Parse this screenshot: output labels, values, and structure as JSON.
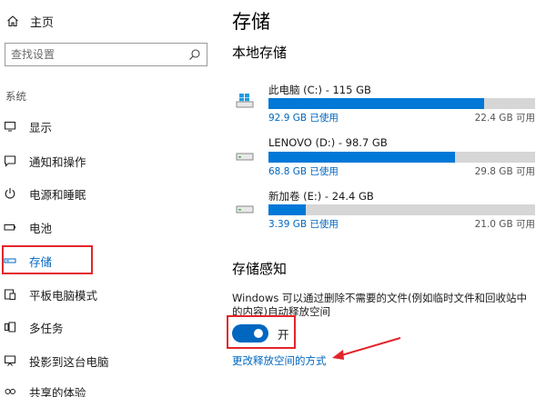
{
  "sidebar": {
    "home_label": "主页",
    "search_placeholder": "查找设置",
    "section_label": "系统",
    "items": [
      {
        "label": "显示",
        "icon": "display-icon"
      },
      {
        "label": "通知和操作",
        "icon": "notification-icon"
      },
      {
        "label": "电源和睡眠",
        "icon": "power-icon"
      },
      {
        "label": "电池",
        "icon": "battery-icon"
      },
      {
        "label": "存储",
        "icon": "storage-icon",
        "active": true
      },
      {
        "label": "平板电脑模式",
        "icon": "tablet-mode-icon"
      },
      {
        "label": "多任务",
        "icon": "multitasking-icon"
      },
      {
        "label": "投影到这台电脑",
        "icon": "projecting-icon"
      },
      {
        "label": "共享的体验",
        "icon": "shared-experience-icon"
      }
    ]
  },
  "main": {
    "title": "存储",
    "local_storage_title": "本地存储",
    "drives": [
      {
        "name": "此电脑 (C:) - 115 GB",
        "used": "92.9 GB 已使用",
        "free": "22.4 GB 可用",
        "used_fraction": 0.81,
        "icon": "windows-drive-icon"
      },
      {
        "name": "LENOVO (D:) - 98.7 GB",
        "used": "68.8 GB 已使用",
        "free": "29.8 GB 可用",
        "used_fraction": 0.7,
        "icon": "hard-drive-icon"
      },
      {
        "name": "新加卷 (E:) - 24.4 GB",
        "used": "3.39 GB 已使用",
        "free": "21.0 GB 可用",
        "used_fraction": 0.14,
        "icon": "hard-drive-icon"
      }
    ],
    "storage_sense_title": "存储感知",
    "storage_sense_desc": "Windows 可以通过删除不需要的文件(例如临时文件和回收站中的内容)自动释放空间",
    "toggle_label": "开",
    "toggle_on": true,
    "link_label": "更改释放空间的方式"
  },
  "colors": {
    "accent": "#0067c0",
    "bar_fill": "#0078d7",
    "bar_track": "#d6d6d6",
    "annotation": "#e3252b"
  }
}
